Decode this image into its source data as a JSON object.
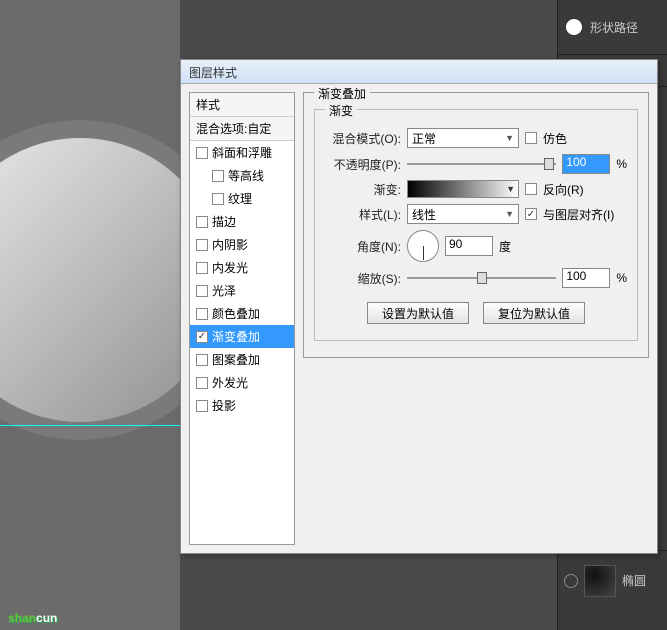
{
  "right_panel": {
    "shape_path": "形状路径",
    "layer_name": "椭圆"
  },
  "dialog": {
    "title": "图层样式",
    "styles_header": "样式",
    "blend_header": "混合选项:自定",
    "items": [
      {
        "label": "斜面和浮雕",
        "checked": false,
        "indent": false
      },
      {
        "label": "等高线",
        "checked": false,
        "indent": true
      },
      {
        "label": "纹理",
        "checked": false,
        "indent": true
      },
      {
        "label": "描边",
        "checked": false,
        "indent": false
      },
      {
        "label": "内阴影",
        "checked": false,
        "indent": false
      },
      {
        "label": "内发光",
        "checked": false,
        "indent": false
      },
      {
        "label": "光泽",
        "checked": false,
        "indent": false
      },
      {
        "label": "颜色叠加",
        "checked": false,
        "indent": false
      },
      {
        "label": "渐变叠加",
        "checked": true,
        "indent": false,
        "selected": true
      },
      {
        "label": "图案叠加",
        "checked": false,
        "indent": false
      },
      {
        "label": "外发光",
        "checked": false,
        "indent": false
      },
      {
        "label": "投影",
        "checked": false,
        "indent": false
      }
    ]
  },
  "gradient_overlay": {
    "section_title": "渐变叠加",
    "subsection_title": "渐变",
    "blend_mode_label": "混合模式(O):",
    "blend_mode_value": "正常",
    "dither_label": "仿色",
    "dither_checked": false,
    "opacity_label": "不透明度(P):",
    "opacity_value": "100",
    "opacity_unit": "%",
    "gradient_label": "渐变:",
    "reverse_label": "反向(R)",
    "reverse_checked": false,
    "style_label": "样式(L):",
    "style_value": "线性",
    "align_label": "与图层对齐(I)",
    "align_checked": true,
    "angle_label": "角度(N):",
    "angle_value": "90",
    "angle_unit": "度",
    "scale_label": "缩放(S):",
    "scale_value": "100",
    "scale_unit": "%",
    "default_btn": "设置为默认值",
    "reset_btn": "复位为默认值"
  },
  "watermark": "shancun"
}
